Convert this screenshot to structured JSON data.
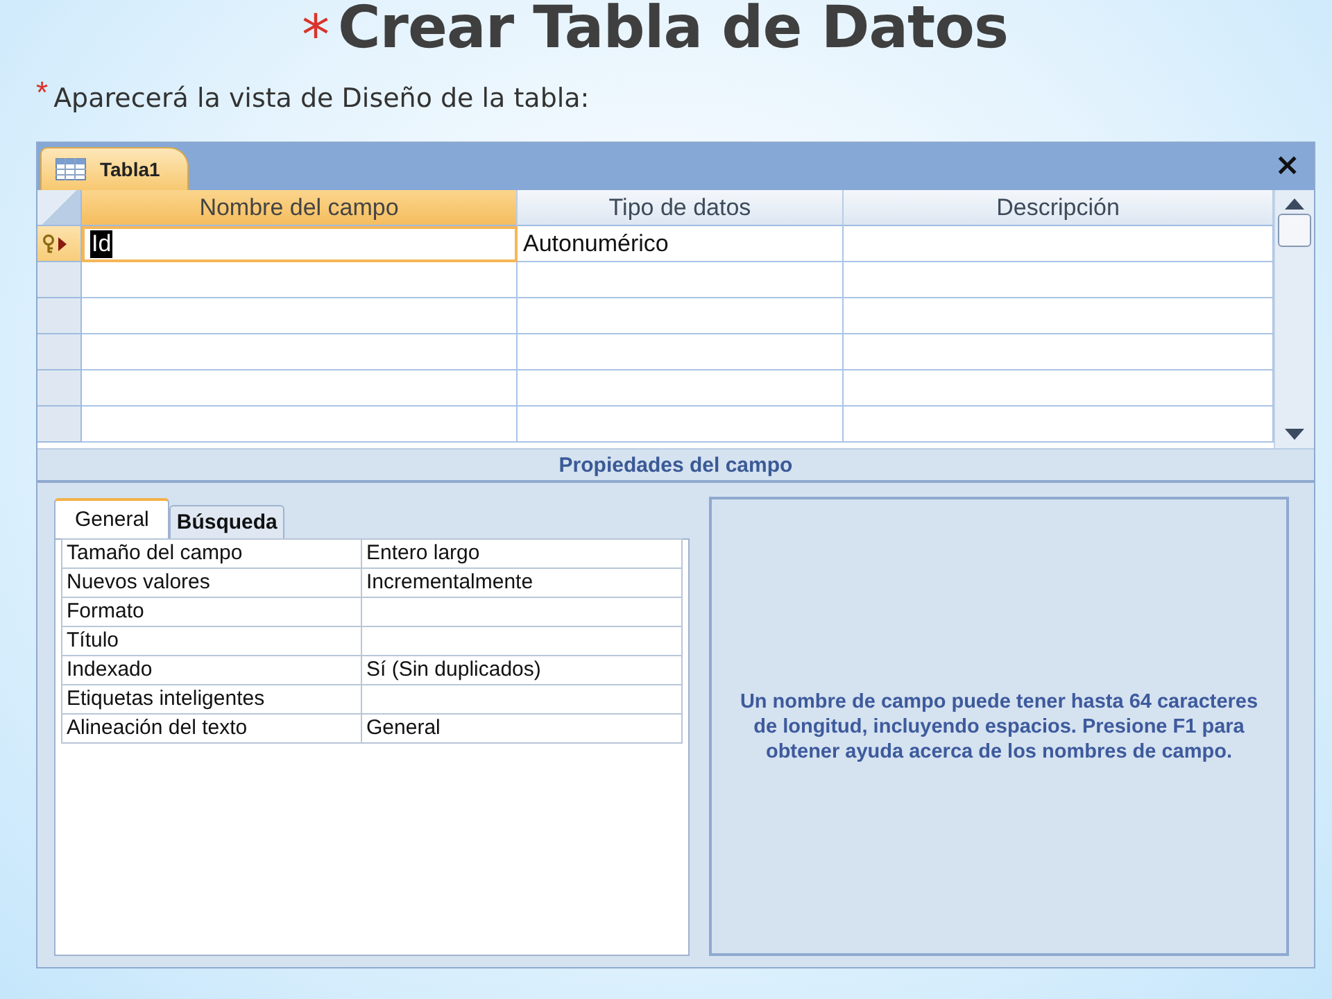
{
  "slide": {
    "title_mark": "*",
    "title": "Crear Tabla de Datos",
    "bullet_mark": "*",
    "bullet": "Aparecerá la vista de Diseño de la tabla:"
  },
  "window": {
    "tab": "Tabla1",
    "close": "×"
  },
  "grid": {
    "columns": [
      {
        "label": "Nombre del campo",
        "selected": true
      },
      {
        "label": "Tipo de datos",
        "selected": false
      },
      {
        "label": "Descripción",
        "selected": false
      }
    ],
    "rows": [
      {
        "current": true,
        "primary_key": true,
        "name": "Id",
        "type": "Autonumérico"
      },
      {
        "current": false,
        "primary_key": false
      },
      {
        "current": false,
        "primary_key": false
      },
      {
        "current": false,
        "primary_key": false
      },
      {
        "current": false,
        "primary_key": false
      },
      {
        "current": false,
        "primary_key": false
      }
    ]
  },
  "properties": {
    "title": "Propiedades del campo",
    "tabs": [
      {
        "label": "General",
        "selected": true
      },
      {
        "label": "Búsqueda",
        "selected": false
      }
    ],
    "rows": [
      {
        "label": "Tamaño del campo",
        "value": "Entero largo"
      },
      {
        "label": "Nuevos valores",
        "value": "Incrementalmente"
      },
      {
        "label": "Formato"
      },
      {
        "label": "Título"
      },
      {
        "label": "Indexado",
        "value": "Sí (Sin duplicados)"
      },
      {
        "label": "Etiquetas inteligentes"
      },
      {
        "label": "Alineación del texto",
        "value": "General"
      }
    ],
    "help": "Un nombre de campo puede tener hasta 64 caracteres de longitud, incluyendo espacios. Presione F1 para obtener ayuda acerca de los nombres de campo."
  }
}
